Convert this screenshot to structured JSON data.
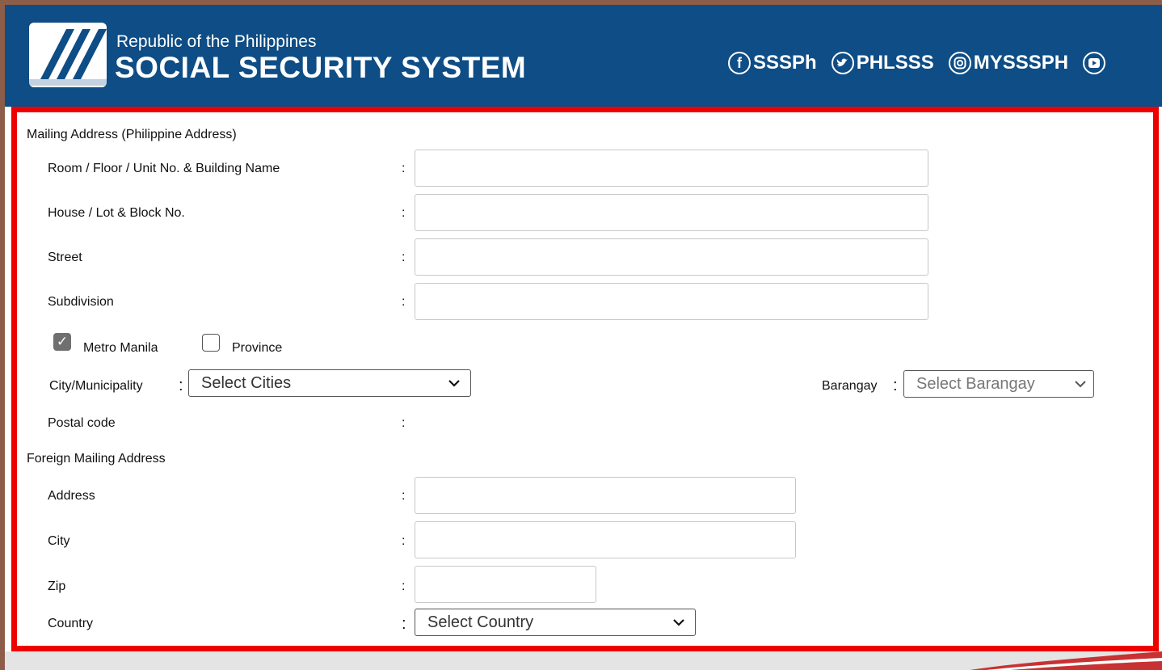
{
  "header": {
    "subtitle": "Republic of the Philippines",
    "title": "SOCIAL SECURITY SYSTEM",
    "socials": [
      {
        "icon": "facebook-icon",
        "glyph": "f",
        "label": "SSSPh"
      },
      {
        "icon": "twitter-icon",
        "glyph": "🐦",
        "label": "PHLSSS"
      },
      {
        "icon": "instagram-icon",
        "glyph": "◎",
        "label": "MYSSSPH"
      },
      {
        "icon": "youtube-icon",
        "glyph": "▶",
        "label": ""
      }
    ]
  },
  "mailing": {
    "section_title": "Mailing Address (Philippine Address)",
    "room_label": "Room / Floor / Unit No. & Building Name",
    "house_label": "House / Lot & Block No.",
    "street_label": "Street",
    "subdivision_label": "Subdivision",
    "metro_manila_label": "Metro Manila",
    "metro_manila_checked": true,
    "province_label": "Province",
    "province_checked": false,
    "city_label": "City/Municipality",
    "city_selected": "Select Cities",
    "barangay_label": "Barangay",
    "barangay_selected": "Select Barangay",
    "postal_label": "Postal code"
  },
  "foreign": {
    "section_title": "Foreign Mailing Address",
    "address_label": "Address",
    "city_label": "City",
    "zip_label": "Zip",
    "country_label": "Country",
    "country_selected": "Select Country"
  },
  "colors": {
    "header_bg": "#0e4d85",
    "highlight_border": "#ee0000"
  }
}
